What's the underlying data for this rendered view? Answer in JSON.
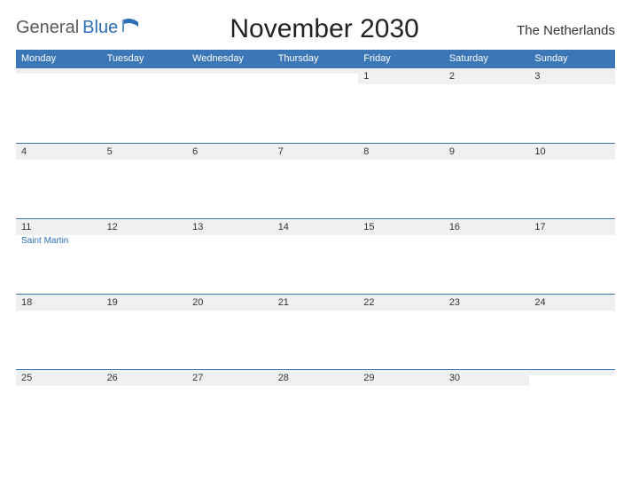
{
  "logo": {
    "a": "General",
    "b": "Blue"
  },
  "title": "November 2030",
  "subtitle": "The Netherlands",
  "weekdays": [
    "Monday",
    "Tuesday",
    "Wednesday",
    "Thursday",
    "Friday",
    "Saturday",
    "Sunday"
  ],
  "weeks": [
    [
      {
        "n": ""
      },
      {
        "n": ""
      },
      {
        "n": ""
      },
      {
        "n": ""
      },
      {
        "n": "1"
      },
      {
        "n": "2"
      },
      {
        "n": "3"
      }
    ],
    [
      {
        "n": "4"
      },
      {
        "n": "5"
      },
      {
        "n": "6"
      },
      {
        "n": "7"
      },
      {
        "n": "8"
      },
      {
        "n": "9"
      },
      {
        "n": "10"
      }
    ],
    [
      {
        "n": "11",
        "evt": "Saint Martin"
      },
      {
        "n": "12"
      },
      {
        "n": "13"
      },
      {
        "n": "14"
      },
      {
        "n": "15"
      },
      {
        "n": "16"
      },
      {
        "n": "17"
      }
    ],
    [
      {
        "n": "18"
      },
      {
        "n": "19"
      },
      {
        "n": "20"
      },
      {
        "n": "21"
      },
      {
        "n": "22"
      },
      {
        "n": "23"
      },
      {
        "n": "24"
      }
    ],
    [
      {
        "n": "25"
      },
      {
        "n": "26"
      },
      {
        "n": "27"
      },
      {
        "n": "28"
      },
      {
        "n": "29"
      },
      {
        "n": "30"
      },
      {
        "n": ""
      }
    ]
  ]
}
